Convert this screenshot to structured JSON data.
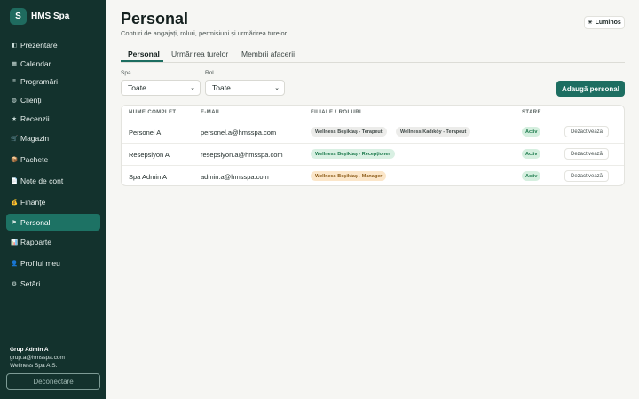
{
  "brand": {
    "logo_letter": "S",
    "name": "HMS Spa"
  },
  "nav": [
    {
      "label": "Prezentare",
      "icon": "dashboard-icon",
      "glyph": "◧",
      "active": false
    },
    {
      "label": "Calendar",
      "icon": "calendar-icon",
      "glyph": "▦",
      "active": false
    },
    {
      "label": "Programări",
      "icon": "list-icon",
      "glyph": "≡",
      "active": false
    },
    {
      "label": "Clienți",
      "icon": "clients-icon",
      "glyph": "◍",
      "active": false
    },
    {
      "label": "Recenzii",
      "icon": "star-icon",
      "glyph": "★",
      "active": false
    },
    {
      "label": "Magazin",
      "icon": "cart-icon",
      "glyph": "🛒",
      "active": false
    },
    {
      "label": "Pachete",
      "icon": "package-icon",
      "glyph": "📦",
      "active": false
    },
    {
      "label": "Note de cont",
      "icon": "receipt-icon",
      "glyph": "📄",
      "active": false
    },
    {
      "label": "Finanțe",
      "icon": "money-bag-icon",
      "glyph": "💰",
      "active": false
    },
    {
      "label": "Personal",
      "icon": "flag-icon",
      "glyph": "⚑",
      "active": true
    },
    {
      "label": "Rapoarte",
      "icon": "chart-icon",
      "glyph": "📊",
      "active": false
    },
    {
      "label": "Profilul meu",
      "icon": "user-icon",
      "glyph": "👤",
      "active": false
    },
    {
      "label": "Setări",
      "icon": "gear-icon",
      "glyph": "⚙",
      "active": false
    }
  ],
  "user": {
    "name": "Grup Admin A",
    "email": "grup.a@hmsspa.com",
    "company": "Wellness Spa A.S."
  },
  "logout_label": "Deconectare",
  "page": {
    "title": "Personal",
    "subtitle": "Conturi de angajați, roluri, permisiuni și urmărirea turelor"
  },
  "theme_toggle": {
    "icon": "sun-icon",
    "glyph": "☀",
    "label": "Luminos"
  },
  "tabs": [
    {
      "label": "Personal",
      "active": true
    },
    {
      "label": "Urmărirea turelor",
      "active": false
    },
    {
      "label": "Membrii afacerii",
      "active": false
    }
  ],
  "filters": {
    "spa": {
      "label": "Spa",
      "value": "Toate"
    },
    "rol": {
      "label": "Rol",
      "value": "Toate"
    }
  },
  "add_button": "Adaugă personal",
  "table": {
    "headers": [
      "NUME COMPLET",
      "E-MAIL",
      "FILIALE / ROLURI",
      "STARE"
    ],
    "rows": [
      {
        "name": "Personel A",
        "email": "personel.a@hmsspa.com",
        "roles": [
          {
            "text": "Wellness Beşiktaş - Terapeut",
            "color": "gray"
          },
          {
            "text": "Wellness Kadıköy - Terapeut",
            "color": "gray"
          }
        ],
        "status": "Activ",
        "action": "Dezactivează"
      },
      {
        "name": "Resepsiyon A",
        "email": "resepsiyon.a@hmsspa.com",
        "roles": [
          {
            "text": "Wellness Beşiktaş - Recepționer",
            "color": "green"
          }
        ],
        "status": "Activ",
        "action": "Dezactivează"
      },
      {
        "name": "Spa Admin A",
        "email": "admin.a@hmsspa.com",
        "roles": [
          {
            "text": "Wellness Beşiktaş - Manager",
            "color": "orange"
          }
        ],
        "status": "Activ",
        "action": "Dezactivează"
      }
    ]
  },
  "colors": {
    "sidebar": "#13322d",
    "accent": "#1d6e61",
    "background": "#f6f6f3"
  }
}
